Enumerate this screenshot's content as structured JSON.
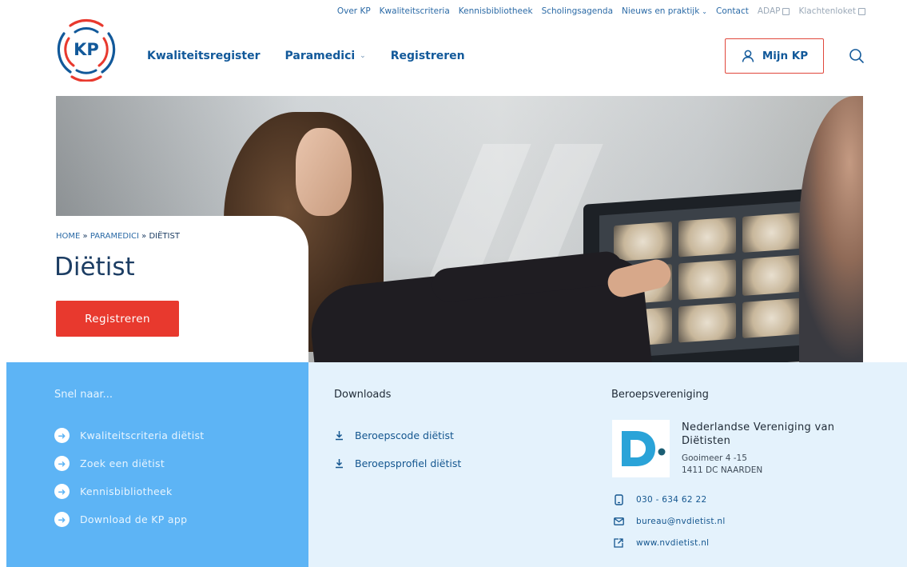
{
  "top_nav": [
    {
      "label": "Over KP",
      "external": false,
      "dropdown": false,
      "muted": false
    },
    {
      "label": "Kwaliteitscriteria",
      "external": false,
      "dropdown": false,
      "muted": false
    },
    {
      "label": "Kennisbibliotheek",
      "external": false,
      "dropdown": false,
      "muted": false
    },
    {
      "label": "Scholingsagenda",
      "external": false,
      "dropdown": false,
      "muted": false
    },
    {
      "label": "Nieuws en praktijk",
      "external": false,
      "dropdown": true,
      "muted": false
    },
    {
      "label": "Contact",
      "external": false,
      "dropdown": false,
      "muted": false
    },
    {
      "label": "ADAP",
      "external": true,
      "dropdown": false,
      "muted": true
    },
    {
      "label": "Klachtenloket",
      "external": true,
      "dropdown": false,
      "muted": true
    }
  ],
  "logo": {
    "text": "KP"
  },
  "main_nav": [
    {
      "label": "Kwaliteitsregister",
      "dropdown": false
    },
    {
      "label": "Paramedici",
      "dropdown": true
    },
    {
      "label": "Registreren",
      "dropdown": false
    }
  ],
  "account": {
    "label": "Mijn KP",
    "icon": "user-icon"
  },
  "hero": {
    "breadcrumb": {
      "home": "HOME",
      "sep1": " » ",
      "parent": "PARAMEDICI",
      "sep2": " » ",
      "current": "DIËTIST"
    },
    "title": "Diëtist",
    "cta_label": "Registreren"
  },
  "quick_links": {
    "title": "Snel naar...",
    "items": [
      "Kwaliteitscriteria diëtist",
      "Zoek een diëtist",
      "Kennisbibliotheek",
      "Download de KP app"
    ]
  },
  "downloads": {
    "title": "Downloads",
    "items": [
      "Beroepscode diëtist",
      "Beroepsprofiel diëtist"
    ]
  },
  "association": {
    "title": "Beroepsvereniging",
    "name": "Nederlandse Vereniging van Diëtisten",
    "address_line1": "Gooimeer 4 -15",
    "address_line2": "1411 DC NAARDEN",
    "phone": "030 - 634 62 22",
    "email": "bureau@nvdietist.nl",
    "website": "www.nvdietist.nl"
  },
  "colors": {
    "brand_blue": "#12599a",
    "accent_red": "#e8392e",
    "panel_blue": "#5db4f5",
    "panel_light": "#e4f2fc"
  }
}
